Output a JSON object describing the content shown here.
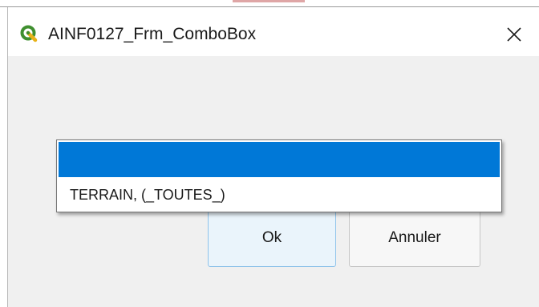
{
  "window": {
    "title": "AINF0127_Frm_ComboBox",
    "icon": "qgis-icon",
    "close_glyph": "✕"
  },
  "combobox": {
    "options": [
      {
        "label": "",
        "selected": true
      },
      {
        "label": "TERRAIN, (_TOUTES_)",
        "selected": false
      }
    ],
    "highlight_color": "#0078d7"
  },
  "buttons": {
    "ok_label": "Ok",
    "cancel_label": "Annuler"
  }
}
